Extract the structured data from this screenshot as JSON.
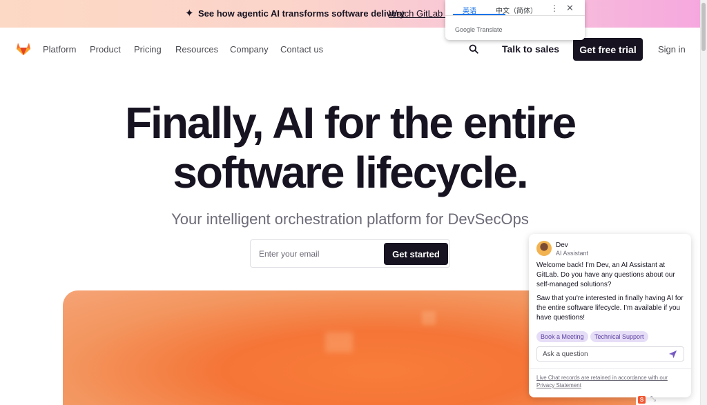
{
  "banner": {
    "text": "See how agentic AI transforms software delivery",
    "link": "Watch GitLab Tr",
    "spark_icon": "sparkle-icon"
  },
  "nav": {
    "logo_icon": "gitlab-tanuki-icon",
    "items": [
      "Platform",
      "Product",
      "Pricing",
      "Resources",
      "Company",
      "Contact us"
    ],
    "search_icon": "search-icon",
    "talk_to_sales": "Talk to sales",
    "free_trial": "Get free trial",
    "sign_in": "Sign in"
  },
  "hero": {
    "title_line1": "Finally, AI for the entire",
    "title_line2": "software lifecycle.",
    "subtitle": "Your intelligent orchestration platform for DevSecOps",
    "email_placeholder": "Enter your email",
    "cta": "Get started"
  },
  "translate": {
    "tab_source": "英语",
    "tab_target": "中文（简体）",
    "brand": "Google Translate"
  },
  "chat": {
    "name": "Dev",
    "role": "AI Assistant",
    "message1": "Welcome back! I'm Dev, an AI Assistant at GitLab. Do you have any questions about our self-managed solutions?",
    "message2": "Saw that you're interested in finally having AI for the entire software lifecycle. I'm available if you have questions!",
    "chips": [
      "Book a Meeting",
      "Technical Support"
    ],
    "input_placeholder": "Ask a question",
    "footer": "Live Chat records are retained in accordance with our Privacy Statement"
  },
  "colors": {
    "dark": "#171321",
    "accent_orange": "#f57537",
    "chip_bg": "#e6ddf7",
    "chip_text": "#5b3fa0",
    "send": "#7759c2"
  }
}
